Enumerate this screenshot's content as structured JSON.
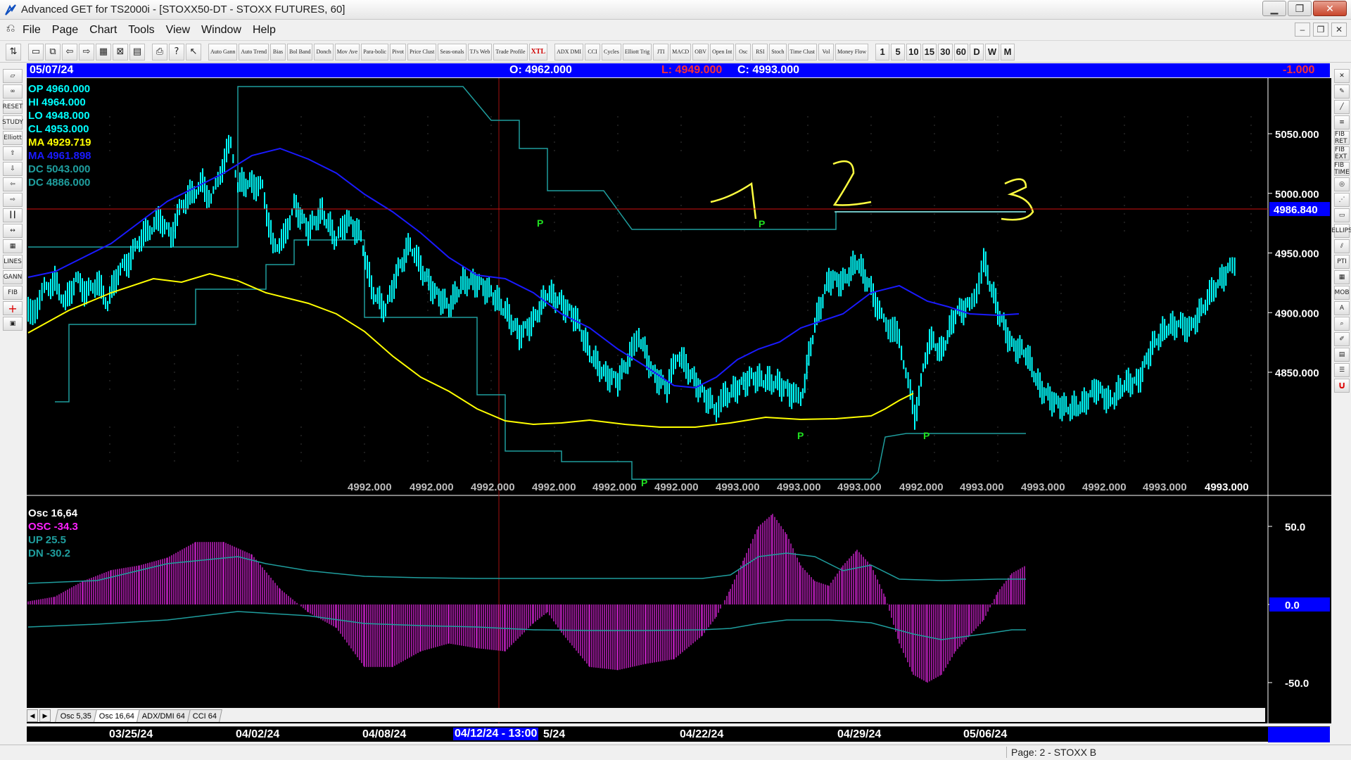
{
  "window": {
    "title": "Advanced GET for TS2000i - [STOXX50-DT - STOXX FUTURES, 60]",
    "minimize": "▁",
    "maximize": "❐",
    "close": "✕"
  },
  "menu": {
    "items": [
      "File",
      "Page",
      "Chart",
      "Tools",
      "View",
      "Window",
      "Help"
    ],
    "mdi_minimize": "–",
    "mdi_restore": "❐",
    "mdi_close": "✕"
  },
  "toolbar": {
    "study_buttons": [
      "Auto Gann",
      "Auto Trend",
      "Bias",
      "Bol Band",
      "Donch",
      "Mov Ave",
      "Para-bolic",
      "Pivot",
      "Price Clust",
      "Seas-onals",
      "TJ's Web",
      "Trade Profile",
      "XTL",
      "ADX DMI",
      "CCI",
      "Cycles",
      "Elliott Trig",
      "JTI",
      "MACD",
      "OBV",
      "Open Int",
      "Osc",
      "RSI",
      "Stoch",
      "Time Clust",
      "Vol",
      "Money Flow"
    ],
    "timeframes": [
      "1",
      "5",
      "10",
      "15",
      "30",
      "60",
      "D",
      "W",
      "M"
    ]
  },
  "left_tools": [
    "RESET",
    "STUDY",
    "Elliott",
    "LINES",
    "GANN",
    "FIB"
  ],
  "right_tools": [
    "FIB RET",
    "FIB EXT",
    "FIB TIME",
    "ELLIPS",
    "PTI",
    "MOB"
  ],
  "infobar": {
    "date": "05/07/24",
    "open": "O: 4962.000",
    "low": "L:  4949.000",
    "close": "C:  4993.000",
    "change": "-1.000"
  },
  "legend": {
    "op": "OP  4960.000",
    "hi": "HI   4964.000",
    "lo": "LO  4948.000",
    "cl": "CL  4953.000",
    "ma1": "MA  4929.719",
    "ma2": "MA  4961.898",
    "dc1": "DC  5043.000",
    "dc2": "DC  4886.000"
  },
  "osc_legend": {
    "title": "Osc 16,64",
    "osc": "OSC -34.3",
    "up": "UP    25.5",
    "dn": "DN    -30.2"
  },
  "price_axis": {
    "labels": [
      "5050.000",
      "5000.000",
      "4950.000",
      "4900.000",
      "4850.000"
    ],
    "current": "4986.840"
  },
  "osc_axis": {
    "labels": [
      "50.0",
      "0.0",
      "-50.0"
    ]
  },
  "bottom_row_values": [
    "4992.000",
    "4992.000",
    "4992.000",
    "4992.000",
    "4992.000",
    "4992.000",
    "4993.000",
    "4993.000",
    "4993.000",
    "4992.000",
    "4993.000",
    "4993.000",
    "4992.000",
    "4993.000",
    "4993.000"
  ],
  "pivot_label": "P",
  "annotations": [
    "1",
    "2",
    "3"
  ],
  "tabs": [
    "Osc 5,35",
    "Osc 16,64",
    "ADX/DMI 64",
    "CCI 64"
  ],
  "dates": {
    "labels": [
      "03/25/24",
      "04/02/24",
      "04/08/24",
      "5/24",
      "04/22/24",
      "04/29/24",
      "05/06/24"
    ],
    "cursor": "04/12/24 - 13:00"
  },
  "status": {
    "page": "Page: 2 - STOXX B"
  },
  "colors": {
    "bars": "#00ffff",
    "ma_yellow": "#ffff00",
    "ma_blue": "#1a1aff",
    "donchian": "#1f9e9e",
    "osc": "#c020c0",
    "pivot": "#20e020"
  }
}
